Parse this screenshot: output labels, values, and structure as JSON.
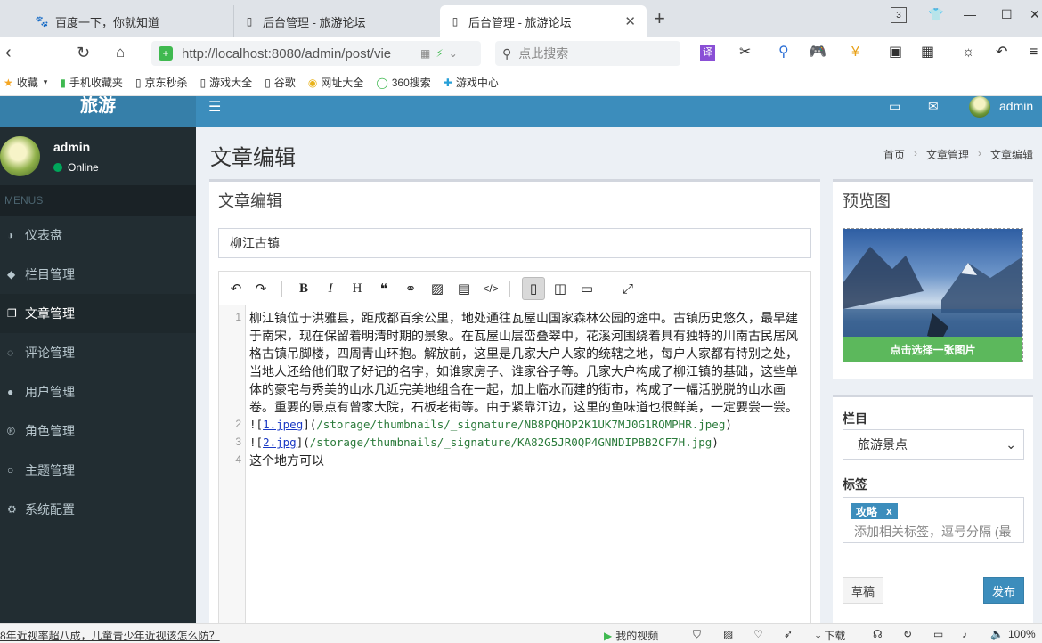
{
  "browser": {
    "tabs": [
      {
        "title": "百度一下，你就知道",
        "icon": "baidu-paw-icon"
      },
      {
        "title": "后台管理 - 旅游论坛",
        "icon": "page-icon"
      },
      {
        "title": "后台管理 - 旅游论坛",
        "icon": "page-icon",
        "active": true
      }
    ],
    "tab_count": "3",
    "url": "http://localhost:8080/admin/post/vie",
    "search_placeholder": "点此搜索",
    "bookmarks": [
      {
        "label": "收藏",
        "icon": "star-icon"
      },
      {
        "label": "手机收藏夹",
        "icon": "phone-icon"
      },
      {
        "label": "京东秒杀",
        "icon": "page-icon"
      },
      {
        "label": "游戏大全",
        "icon": "page-icon"
      },
      {
        "label": "谷歌",
        "icon": "page-icon"
      },
      {
        "label": "网址大全",
        "icon": "nav-site-icon"
      },
      {
        "label": "360搜索",
        "icon": "360-search-icon"
      },
      {
        "label": "游戏中心",
        "icon": "game-center-icon"
      }
    ]
  },
  "app": {
    "logo": "旅游",
    "header_user": "admin",
    "colors": {
      "header": "#3c8dbc",
      "logo_bg": "#367fa9",
      "sidebar": "#222d32",
      "success": "#5cb85c"
    }
  },
  "sidebar": {
    "user": {
      "name": "admin",
      "status": "Online"
    },
    "section_label": "MENUS",
    "items": [
      {
        "label": "仪表盘",
        "icon": "dashboard-icon"
      },
      {
        "label": "栏目管理",
        "icon": "tags-icon"
      },
      {
        "label": "文章管理",
        "icon": "copy-icon",
        "active": true
      },
      {
        "label": "评论管理",
        "icon": "comment-icon"
      },
      {
        "label": "用户管理",
        "icon": "user-icon"
      },
      {
        "label": "角色管理",
        "icon": "registered-icon"
      },
      {
        "label": "主题管理",
        "icon": "circle-icon"
      },
      {
        "label": "系统配置",
        "icon": "gear-icon"
      }
    ]
  },
  "page": {
    "title": "文章编辑",
    "breadcrumb": [
      "首页",
      "文章管理",
      "文章编辑"
    ]
  },
  "editor": {
    "box_title": "文章编辑",
    "post_title": "柳江古镇",
    "line_numbers": [
      "1",
      "2",
      "3",
      "4"
    ],
    "paragraph": "柳江镇位于洪雅县，距成都百余公里，地处通往瓦屋山国家森林公园的途中。古镇历史悠久，最早建于南宋，现在保留着明清时期的景象。在瓦屋山层峦叠翠中，花溪河围绕着具有独特的川南古民居风格古镇吊脚楼，四周青山环抱。解放前，这里是几家大户人家的统辖之地，每户人家都有特别之处，当地人还给他们取了好记的名字，如谁家房子、谁家谷子等。几家大户构成了柳江镇的基础，这些单体的豪宅与秀美的山水几近完美地组合在一起，加上临水而建的街市，构成了一幅活脱脱的山水画卷。重要的景点有曾家大院，石板老街等。由于紧靠江边，这里的鱼味道也很鲜美，一定要尝一尝。",
    "image_lines": [
      {
        "prefix": "![",
        "name": "1.jpeg",
        "mid": "](",
        "path": "/storage/thumbnails/_signature/NB8PQHOP2K1UK7MJ0G1RQMPHR.jpeg",
        "suffix": ")"
      },
      {
        "prefix": "![",
        "name": "2.jpg",
        "mid": "](",
        "path": "/storage/thumbnails/_signature/KA82G5JR0QP4GNNDIPBB2CF7H.jpg",
        "suffix": ")"
      }
    ],
    "last_line": "这个地方可以"
  },
  "preview": {
    "title": "预览图",
    "pick_label": "点击选择一张图片"
  },
  "meta": {
    "category_label": "栏目",
    "category_value": "旅游景点",
    "tags_label": "标签",
    "tags": [
      {
        "label": "攻略",
        "remove": "x"
      }
    ],
    "tags_placeholder": "添加相关标签，逗号分隔 (最",
    "draft_label": "草稿",
    "publish_label": "发布"
  },
  "statusbar": {
    "news": "8年近视率超八成，儿童青少年近视该怎么防？",
    "video": "我的视频",
    "download": "下载",
    "zoom": "100%"
  }
}
